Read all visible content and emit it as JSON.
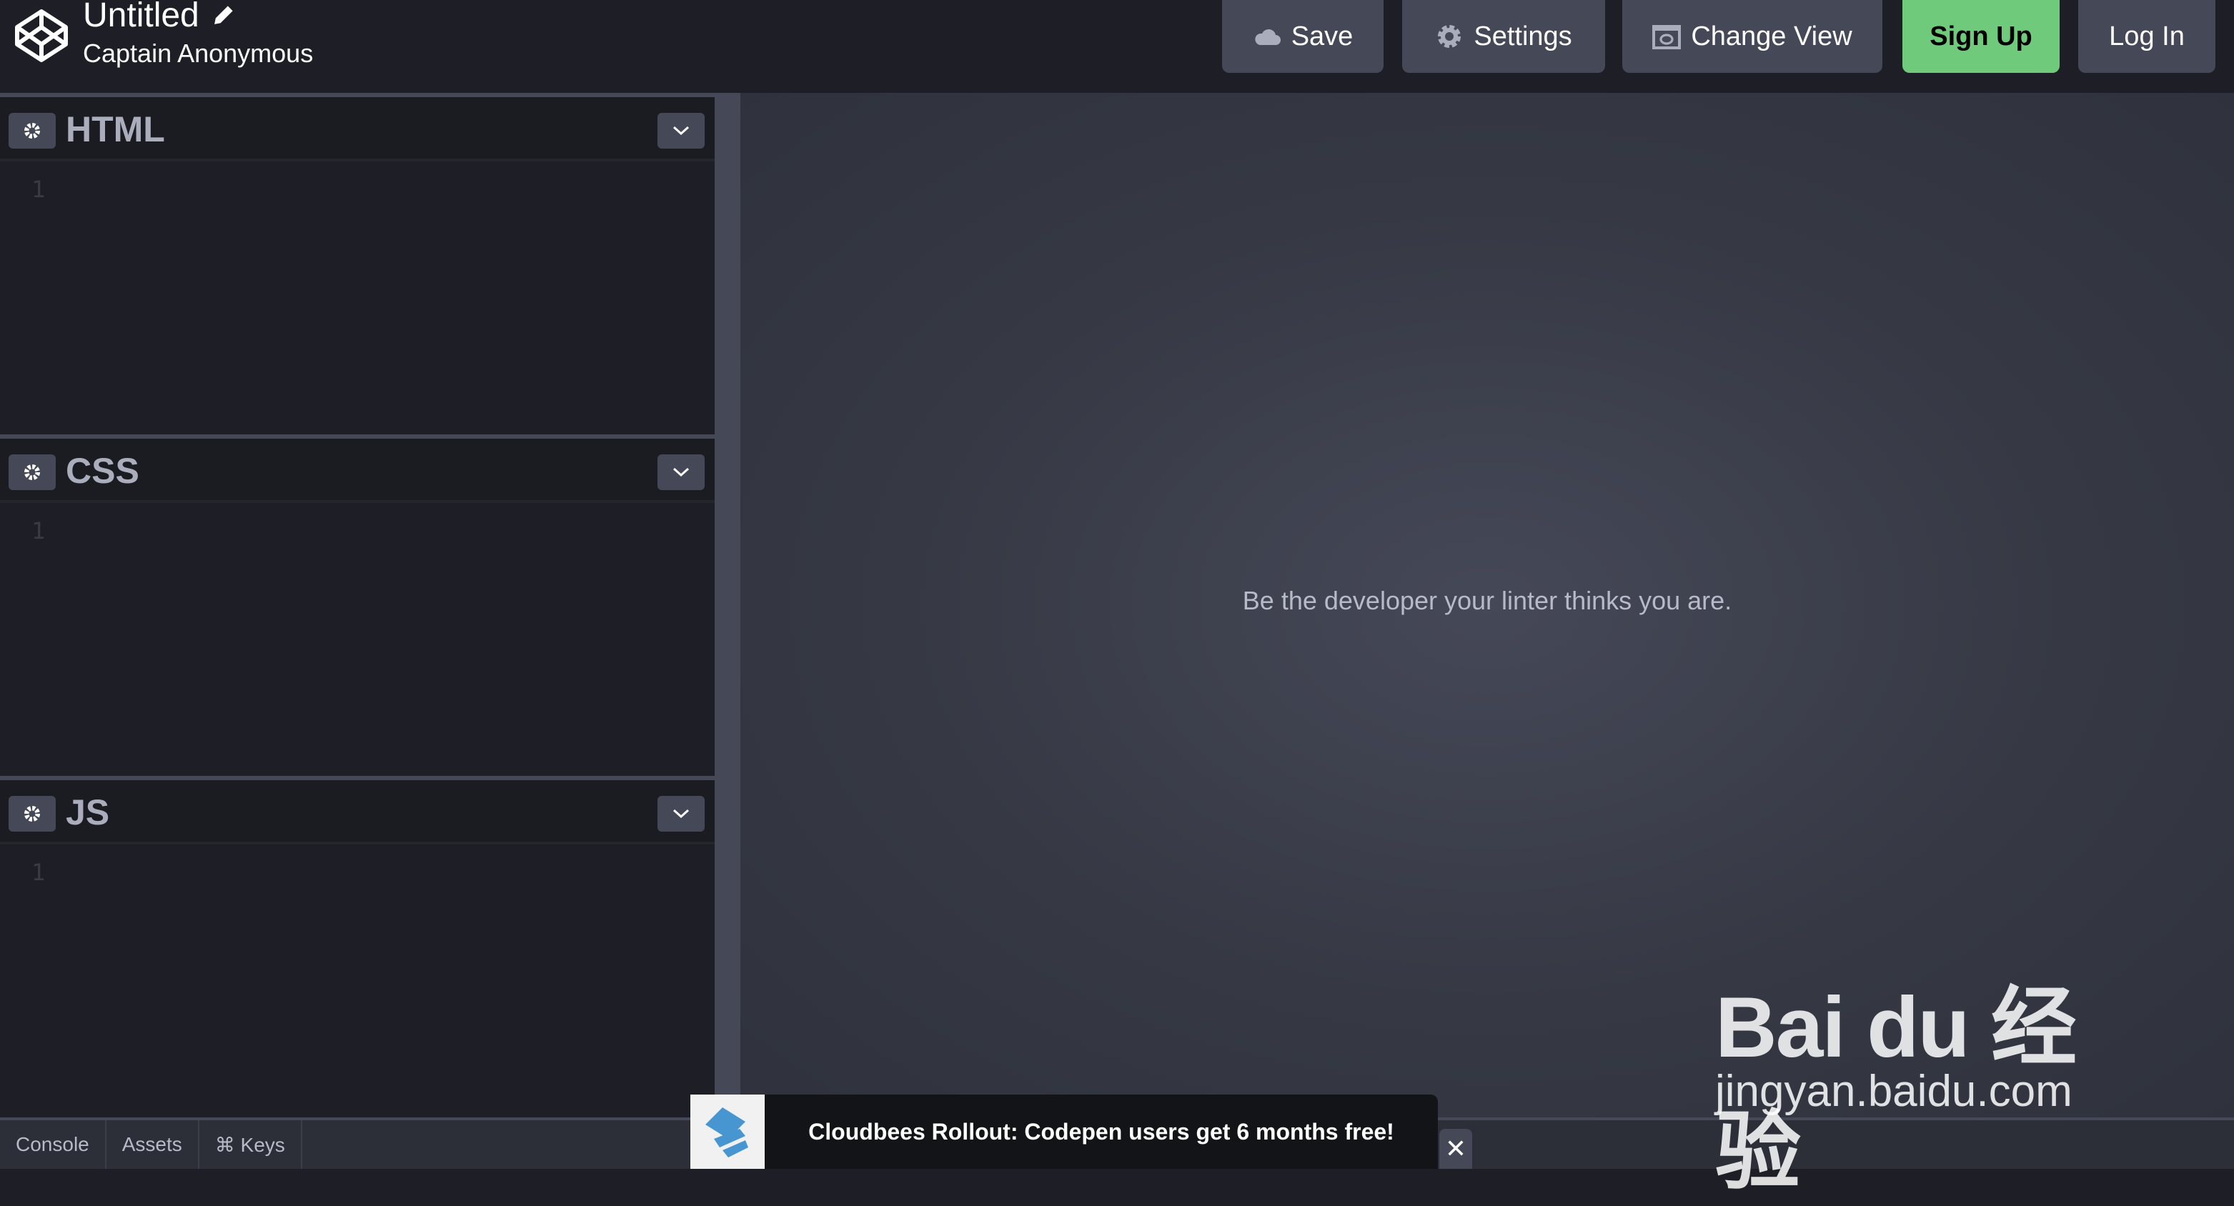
{
  "header": {
    "title": "Untitled",
    "owner": "Captain Anonymous",
    "buttons": {
      "save": "Save",
      "settings": "Settings",
      "change_view": "Change View",
      "sign_up": "Sign Up",
      "log_in": "Log In"
    },
    "sign_up_color": "#6fcb7b"
  },
  "editors": [
    {
      "name": "HTML",
      "line": "1"
    },
    {
      "name": "CSS",
      "line": "1"
    },
    {
      "name": "JS",
      "line": "1"
    }
  ],
  "preview": {
    "tagline": "Be the developer your linter thinks you are."
  },
  "footer": {
    "tabs": [
      "Console",
      "Assets",
      "⌘ Keys"
    ]
  },
  "ad": {
    "text": "Cloudbees Rollout: Codepen users get 6 months free!",
    "close": "✕"
  },
  "watermark": {
    "brand": "Bai du 经验",
    "url": "jingyan.baidu.com"
  }
}
